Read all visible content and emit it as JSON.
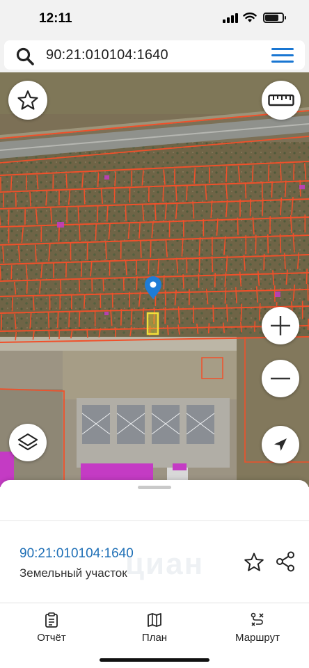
{
  "status_bar": {
    "time": "12:11",
    "battery_level": 0.8
  },
  "search": {
    "query": "90:21:010104:1640",
    "icon": "search-icon",
    "menu_icon": "hamburger-menu-icon"
  },
  "map": {
    "buttons": {
      "favorite": "star-icon",
      "ruler": "ruler-icon",
      "zoom_in": "plus-icon",
      "zoom_out": "minus-icon",
      "layers": "layers-icon",
      "locate": "location-arrow-icon"
    },
    "colors": {
      "parcel_boundary": "#f0502a",
      "selected_parcel": "#f4e03a",
      "marker": "#1e7cd6"
    }
  },
  "sheet": {
    "parcel_id": "90:21:010104:1640",
    "parcel_type": "Земельный участок",
    "watermark": "циан"
  },
  "tabbar": {
    "tabs": [
      {
        "label": "Отчёт",
        "icon": "report-icon"
      },
      {
        "label": "План",
        "icon": "map-plan-icon"
      },
      {
        "label": "Маршрут",
        "icon": "route-icon"
      }
    ]
  }
}
